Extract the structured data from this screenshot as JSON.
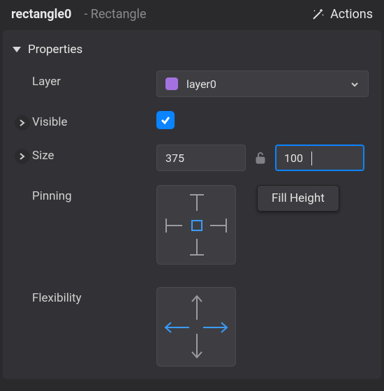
{
  "header": {
    "object_name": "rectangle0",
    "object_type": "- Rectangle",
    "actions_label": "Actions"
  },
  "section": {
    "title": "Properties"
  },
  "rows": {
    "layer_label": "Layer",
    "visible_label": "Visible",
    "size_label": "Size",
    "pinning_label": "Pinning",
    "flexibility_label": "Flexibility"
  },
  "layer": {
    "selected_name": "layer0",
    "swatch_color": "#a472e0"
  },
  "visible": {
    "checked": true
  },
  "size": {
    "w": "375",
    "h": "100",
    "locked": false,
    "focused": "h"
  },
  "pinning": {
    "fill_button_label": "Fill Height"
  },
  "colors": {
    "accent": "#0a84ff",
    "active_arrow": "#3a9cff"
  }
}
